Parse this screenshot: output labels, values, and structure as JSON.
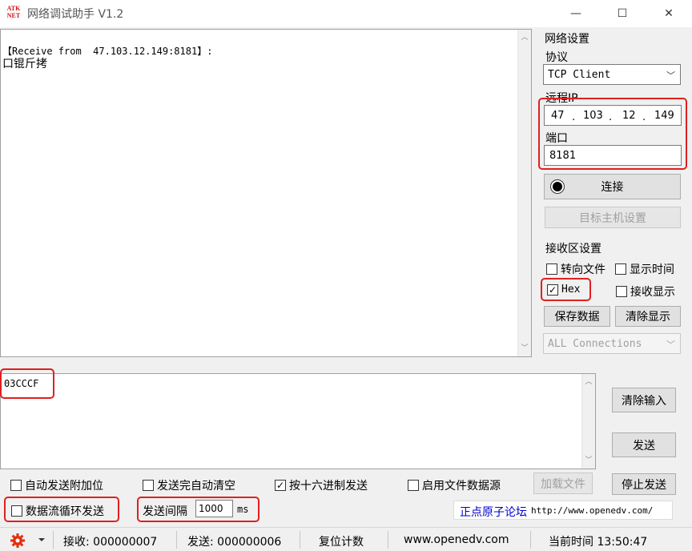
{
  "window": {
    "logo_text": "ATK NET",
    "title": "网络调试助手 V1.2",
    "minimize": "—",
    "maximize": "☐",
    "close": "✕"
  },
  "receive_area": {
    "line1": "【Receive from  47.103.12.149:8181】:",
    "line2": "口锟斤拷"
  },
  "net_settings": {
    "group_title": "网络设置",
    "protocol_label": "协议",
    "protocol_value": "TCP Client",
    "remote_ip_label": "远程IP",
    "ip": [
      "47",
      "103",
      "12",
      "149"
    ],
    "port_label": "端口",
    "port_value": "8181",
    "connect_button": "连接",
    "target_host_button": "目标主机设置"
  },
  "receive_settings": {
    "group_title": "接收区设置",
    "redirect_file": "转向文件",
    "show_time": "显示时间",
    "hex": "Hex",
    "hex_checked": true,
    "recv_show": "接收显示",
    "save_data": "保存数据",
    "clear_display": "清除显示",
    "connections_value": "ALL Connections"
  },
  "send_area": {
    "value": "03CCCF",
    "clear_input": "清除输入",
    "send": "发送"
  },
  "options": {
    "auto_append": "自动发送附加位",
    "auto_clear": "发送完自动清空",
    "hex_send": "按十六进制发送",
    "hex_send_checked": true,
    "file_source": "启用文件数据源",
    "load_file": "加载文件",
    "stop_send": "停止发送",
    "loop_send": "数据流循环发送",
    "interval_label": "发送间隔",
    "interval_value": "1000",
    "interval_unit": "ms",
    "forum_label": "正点原子论坛",
    "forum_url": "http://www.openedv.com/"
  },
  "status": {
    "receive": "接收: 000000007",
    "send": "发送: 000000006",
    "reset": "复位计数",
    "site": "www.openedv.com",
    "time": "当前时间 13:50:47"
  },
  "colors": {
    "highlight": "#e02020",
    "forum_label": "#0000cc"
  }
}
